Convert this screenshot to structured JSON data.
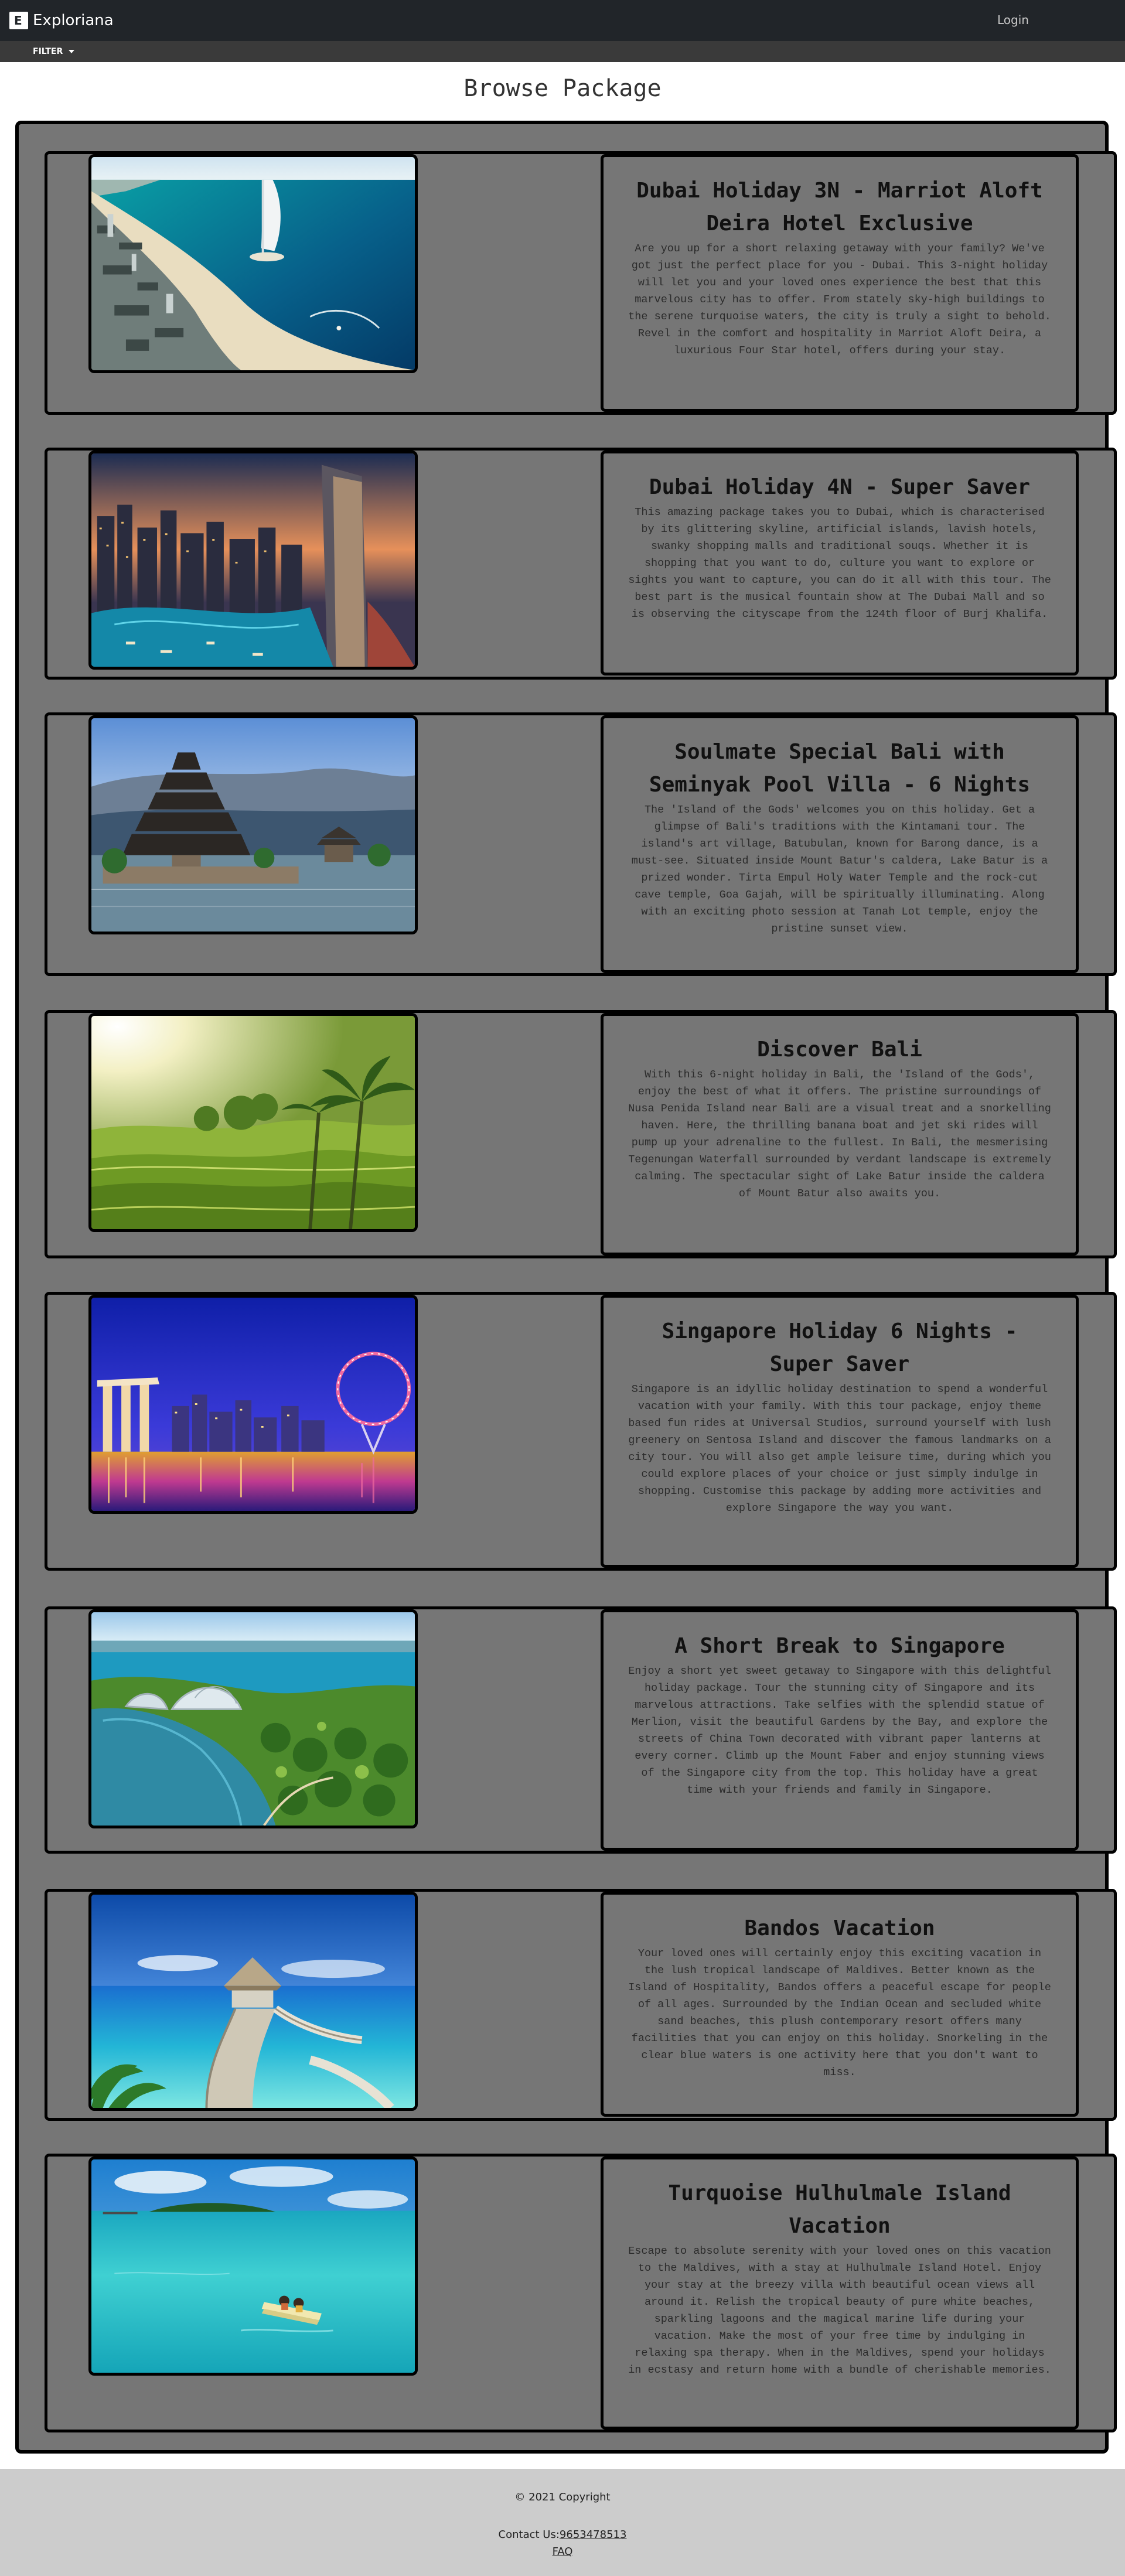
{
  "nav": {
    "brand_logo_letter": "E",
    "brand_name": "Exploriana",
    "login_label": "Login",
    "filter_label": "FILTER"
  },
  "page": {
    "title": "Browse Package"
  },
  "colors": {
    "navbar": "#212529",
    "panel": "#767676",
    "footer": "#cccccc"
  },
  "packages": [
    {
      "title": "Dubai Holiday 3N - Marriot Aloft Deira Hotel Exclusive",
      "description": "Are you up for a short relaxing getaway with your family? We've got just the perfect place for you - Dubai. This 3-night holiday will let you and your loved ones experience the best that this marvelous city has to offer. From stately sky-high buildings to the serene turquoise waters, the city is truly a sight to behold. Revel in the comfort and hospitality in Marriot Aloft Deira, a luxurious Four Star hotel, offers during your stay.",
      "image": "dubai-burj-al-arab-photo"
    },
    {
      "title": "Dubai Holiday 4N - Super Saver",
      "description": "This amazing package takes you to Dubai, which is characterised by its glittering skyline, artificial islands, lavish hotels, swanky shopping malls and traditional souqs. Whether it is shopping that you want to do, culture you want to explore or sights you want to capture, you can do it all with this tour. The best part is the musical fountain show at The Dubai Mall and so is observing the cityscape from the 124th floor of Burj Khalifa.",
      "image": "dubai-marina-skyline-photo"
    },
    {
      "title": "Soulmate Special Bali with Seminyak Pool Villa - 6 Nights",
      "description": "The 'Island of the Gods' welcomes you on this holiday. Get a glimpse of Bali's traditions with the Kintamani tour. The island's art village, Batubulan, known for Barong dance, is a must-see. Situated inside Mount Batur's caldera, Lake Batur is a prized wonder. Tirta Empul Holy Water Temple and the rock-cut cave temple, Goa Gajah, will be spiritually illuminating. Along with an exciting photo session at Tanah Lot temple, enjoy the pristine sunset view.",
      "image": "bali-temple-lake-photo"
    },
    {
      "title": "Discover Bali",
      "description": "With this 6-night holiday in Bali, the 'Island of the Gods', enjoy the best of what it offers. The pristine surroundings of Nusa Penida Island near Bali are a visual treat and a snorkelling haven. Here, the thrilling banana boat and jet ski rides will pump up your adrenaline to the fullest. In Bali, the mesmerising Tegenungan Waterfall surrounded by verdant landscape is extremely calming. The spectacular sight of Lake Batur inside the caldera of Mount Batur also awaits you.",
      "image": "bali-rice-terrace-photo"
    },
    {
      "title": "Singapore Holiday 6 Nights - Super Saver",
      "description": "Singapore is an idyllic holiday destination to spend a wonderful vacation with your family. With this tour package, enjoy theme based fun rides at Universal Studios, surround yourself with lush greenery on Sentosa Island and discover the famous landmarks on a city tour. You will also get ample leisure time, during which you could explore places of your choice or just simply indulge in shopping. Customise this package by adding more activities and explore Singapore the way you want.",
      "image": "singapore-night-skyline-photo"
    },
    {
      "title": "A Short Break to Singapore",
      "description": "Enjoy a short yet sweet getaway to Singapore with this delightful holiday package. Tour the stunning city of Singapore and its marvelous attractions. Take selfies with the splendid statue of Merlion, visit the beautiful Gardens by the Bay, and explore the streets of China Town decorated with vibrant paper lanterns at every corner. Climb up the Mount Faber and enjoy stunning views of the Singapore city from the top. This holiday have a great time with your friends and family in Singapore.",
      "image": "singapore-gardens-by-the-bay-photo"
    },
    {
      "title": "Bandos Vacation",
      "description": "Your loved ones will certainly enjoy this exciting vacation in the lush tropical landscape of Maldives. Better known as the Island of Hospitality, Bandos offers a peaceful escape for people of all ages. Surrounded by the Indian Ocean and secluded white sand beaches, this plush contemporary resort offers many facilities that you can enjoy on this holiday. Snorkeling in the clear blue waters is one activity here that you don't want to miss.",
      "image": "maldives-jetty-hut-photo"
    },
    {
      "title": "Turquoise Hulhulmale Island Vacation",
      "description": "Escape to absolute serenity with your loved ones on this vacation to the Maldives, with a stay at Hulhulmale Island Hotel. Enjoy your stay at the breezy villa with beautiful ocean views all around it. Relish the tropical beauty of pure white beaches, sparkling lagoons and the magical marine life during your vacation. Make the most of your free time by indulging in relaxing spa therapy. When in the Maldives, spend your holidays in ecstasy and return home with a bundle of cherishable memories.",
      "image": "maldives-lagoon-pedal-boat-photo"
    }
  ],
  "footer": {
    "copyright": "© 2021 Copyright",
    "contact_label": "Contact Us:",
    "contact_phone": "9653478513",
    "faq_label": "FAQ"
  }
}
